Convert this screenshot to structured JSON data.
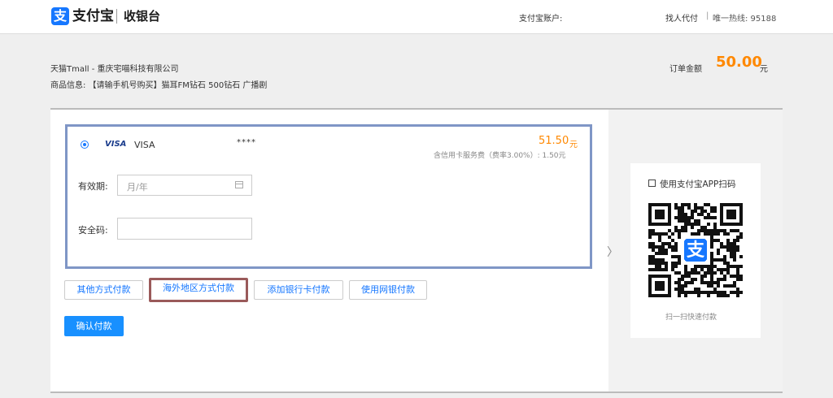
{
  "header": {
    "logo_text": "支付宝",
    "logo_icon": "alipay-icon",
    "logo_glyph": "支",
    "sub_title": "收银台",
    "account_label": "支付宝账户:",
    "proxy_link": "找人代付",
    "separator": "|",
    "hotline": "唯一热线: 95188"
  },
  "order": {
    "merchant": "天猫Tmall - 重庆宅喵科技有限公司",
    "product": "商品信息: 【请输手机号购买】猫耳FM钻石 500钻石 广播剧",
    "amount_label": "订单金额",
    "amount_value": "50.00",
    "amount_unit": "元"
  },
  "card": {
    "brand_logo": "VISA",
    "name": "VISA",
    "mask": "****",
    "price": "51.50",
    "price_unit": "元",
    "fee_note": "含信用卡服务费（费率3.00%）: 1.50元",
    "expiry_label": "有效期:",
    "expiry_placeholder": "月/年",
    "cvv_label": "安全码:"
  },
  "payment_options": [
    {
      "label": "其他方式付款"
    },
    {
      "label": "海外地区方式付款"
    },
    {
      "label": "添加银行卡付款"
    },
    {
      "label": "使用网银付款"
    }
  ],
  "confirm_label": "确认付款",
  "qr": {
    "title": "使用支付宝APP扫码",
    "caption": "扫一扫快速付款",
    "center_glyph": "支"
  },
  "colors": {
    "accent": "#1677ff",
    "price": "#ff8800",
    "highlight_border": "#9a5a5a",
    "card_border": "#7f96c6"
  }
}
